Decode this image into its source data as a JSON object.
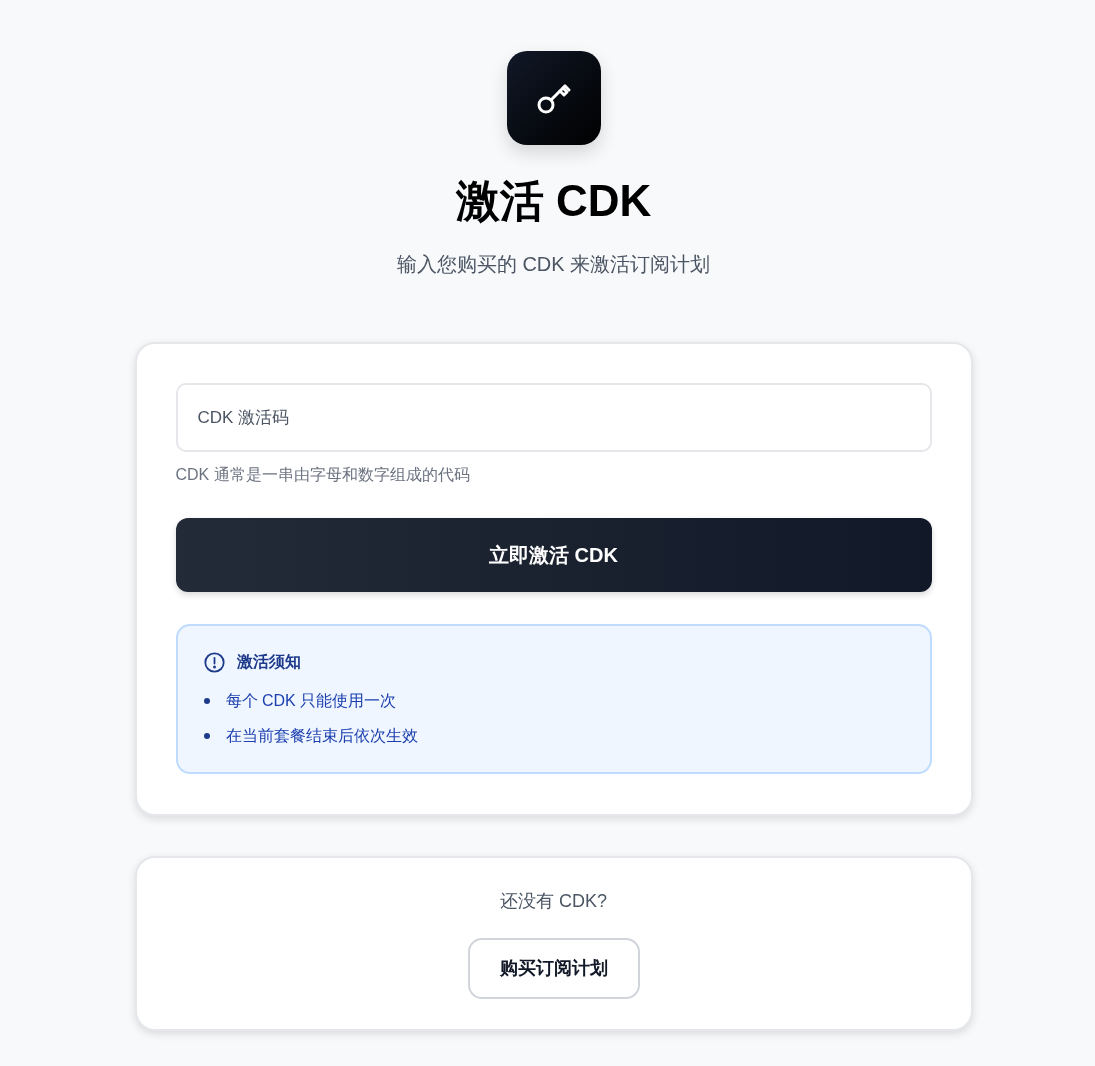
{
  "header": {
    "title": "激活 CDK",
    "subtitle": "输入您购买的 CDK 来激活订阅计划"
  },
  "form": {
    "code_field": {
      "placeholder": "CDK 激活码"
    },
    "hint": "CDK 通常是一串由字母和数字组成的代码",
    "submit_button": "立即激活 CDK",
    "notice": {
      "title": "激活须知",
      "items": [
        "每个 CDK 只能使用一次",
        "在当前套餐结束后依次生效"
      ]
    }
  },
  "purchase": {
    "prompt": "还没有 CDK?",
    "button": "购买订阅计划"
  }
}
